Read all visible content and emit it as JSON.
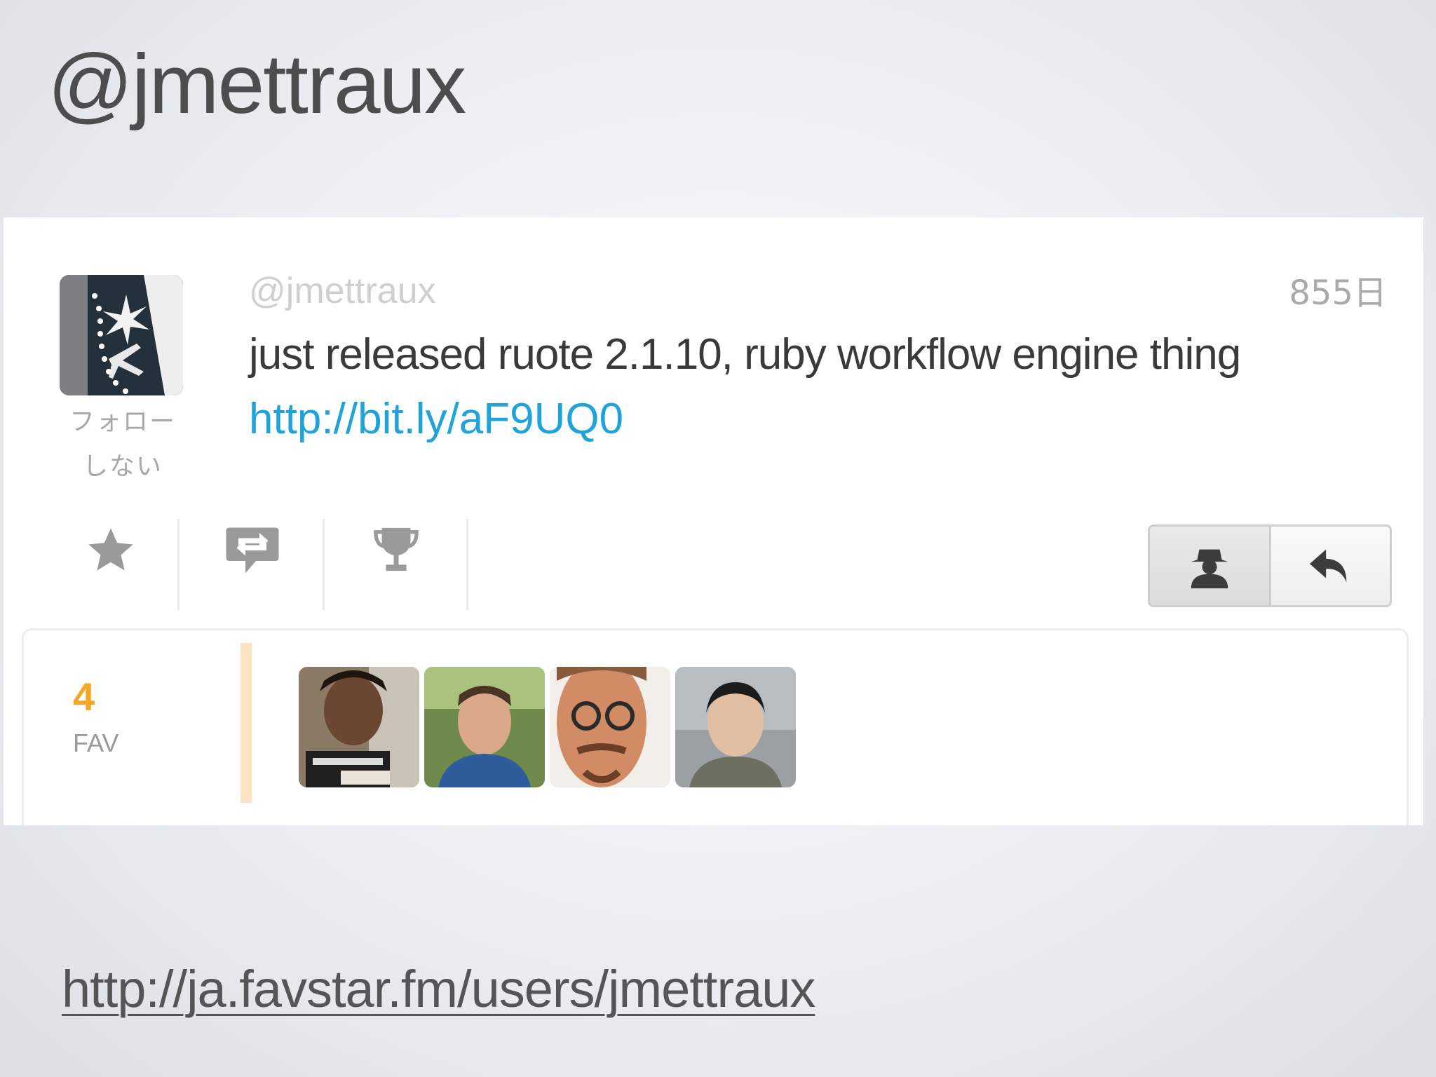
{
  "slide": {
    "title": "@jmettraux",
    "footer_link": "http://ja.favstar.fm/users/jmettraux"
  },
  "tweet": {
    "handle": "@jmettraux",
    "time": "855日",
    "text": "just released ruote 2.1.10, ruby workflow engine thing",
    "link": "http://bit.ly/aF9UQ0",
    "follow_label_line1": "フォロー",
    "follow_label_line2": "しない"
  },
  "actions": {
    "icons": [
      "star-icon",
      "retweet-icon",
      "trophy-icon"
    ],
    "right_buttons": [
      "user-spy-icon",
      "reply-icon"
    ]
  },
  "fav": {
    "count": "4",
    "label": "FAV",
    "accent_color": "#f5a623",
    "avatars": [
      "fav-user-avatar-1",
      "fav-user-avatar-2",
      "fav-user-avatar-3",
      "fav-user-avatar-4"
    ]
  },
  "colors": {
    "link": "#1fa3d9",
    "text": "#3a3a3a",
    "muted": "#aaaaaa"
  }
}
